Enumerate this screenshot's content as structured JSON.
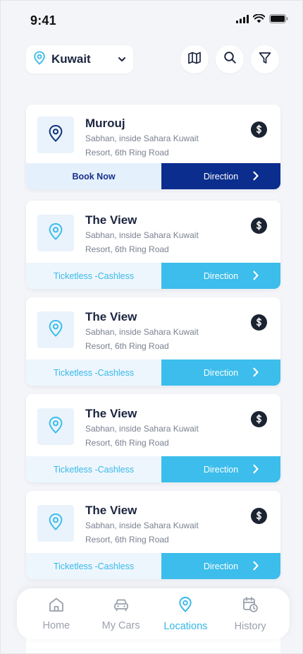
{
  "status_bar": {
    "time": "9:41"
  },
  "top_bar": {
    "location": "Kuwait",
    "location_icon": "map-pin-icon",
    "dropdown_icon": "chevron-down-icon",
    "actions": [
      "map-icon",
      "search-icon",
      "filter-icon"
    ]
  },
  "cards": [
    {
      "title": "Murouj",
      "address_line1": "Sabhan, inside Sahara Kuwait",
      "address_line2": "Resort, 6th Ring Road",
      "tag": "Book Now",
      "action": "Direction",
      "style": "primary"
    },
    {
      "title": "The View",
      "address_line1": "Sabhan, inside Sahara Kuwait",
      "address_line2": "Resort, 6th Ring Road",
      "tag": "Ticketless -Cashless",
      "action": "Direction",
      "style": "secondary"
    },
    {
      "title": "The View",
      "address_line1": "Sabhan, inside Sahara Kuwait",
      "address_line2": "Resort, 6th Ring Road",
      "tag": "Ticketless -Cashless",
      "action": "Direction",
      "style": "secondary"
    },
    {
      "title": "The View",
      "address_line1": "Sabhan, inside Sahara Kuwait",
      "address_line2": "Resort, 6th Ring Road",
      "tag": "Ticketless -Cashless",
      "action": "Direction",
      "style": "secondary"
    },
    {
      "title": "The View",
      "address_line1": "Sabhan, inside Sahara Kuwait",
      "address_line2": "Resort, 6th Ring Road",
      "tag": "Ticketless -Cashless",
      "action": "Direction",
      "style": "secondary"
    }
  ],
  "nav": {
    "items": [
      {
        "label": "Home",
        "icon": "home-icon",
        "active": false
      },
      {
        "label": "My Cars",
        "icon": "car-icon",
        "active": false
      },
      {
        "label": "Locations",
        "icon": "map-pin-icon",
        "active": true
      },
      {
        "label": "History",
        "icon": "calendar-clock-icon",
        "active": false
      }
    ]
  },
  "colors": {
    "primary_dark": "#0b2d8d",
    "accent": "#3cbdeb",
    "text_dark": "#1b2540",
    "text_muted": "#7a8190",
    "nav_inactive": "#9aa1ad",
    "background": "#f3f5f8"
  }
}
